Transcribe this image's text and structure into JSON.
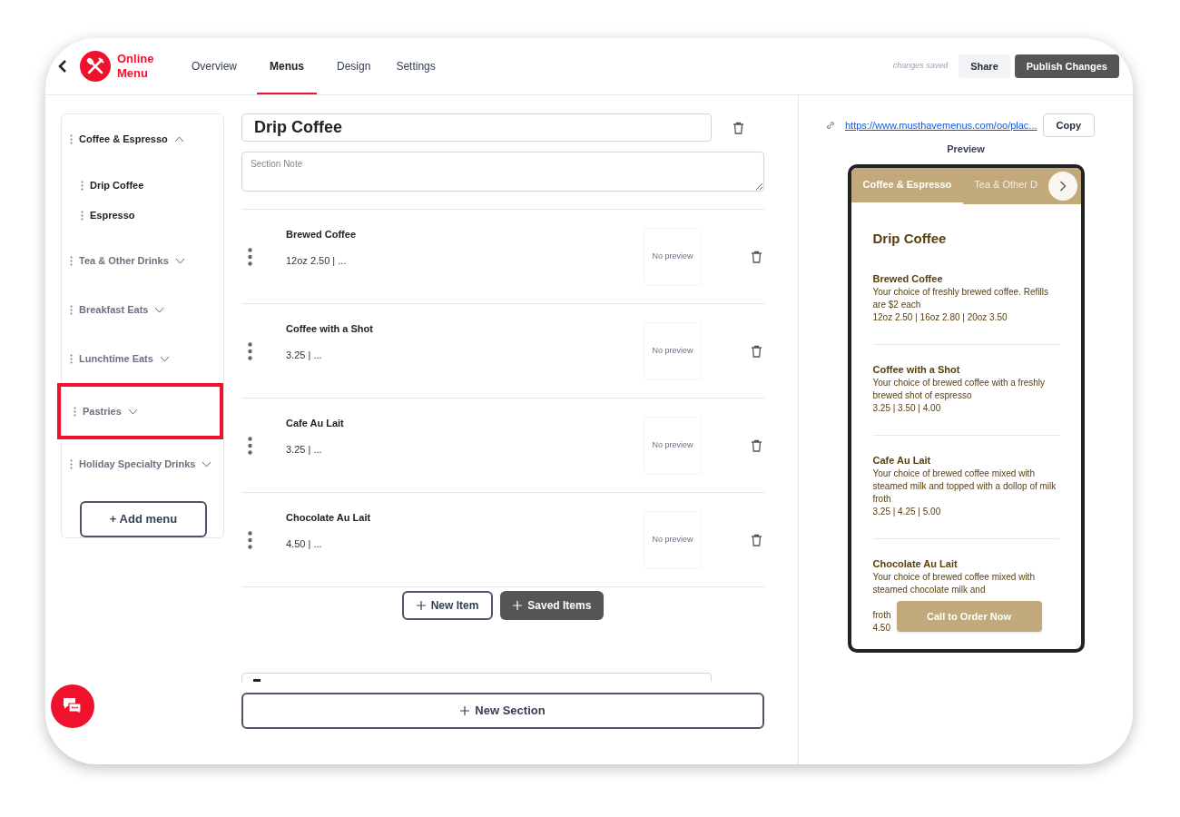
{
  "header": {
    "app_name": "Online Menu",
    "tabs": [
      {
        "label": "Overview",
        "selected": false
      },
      {
        "label": "Menus",
        "selected": true
      },
      {
        "label": "Design",
        "selected": false
      },
      {
        "label": "Settings",
        "selected": false
      }
    ],
    "save_status": "changes saved",
    "share": "Share",
    "publish": "Publish Changes"
  },
  "sidebar": {
    "menus": [
      {
        "label": "Coffee & Espresso",
        "expanded": true,
        "highlighted": false,
        "children": [
          {
            "label": "Drip Coffee"
          },
          {
            "label": "Espresso"
          }
        ]
      },
      {
        "label": "Tea & Other Drinks",
        "expanded": false,
        "highlighted": false
      },
      {
        "label": "Breakfast Eats",
        "expanded": false,
        "highlighted": false
      },
      {
        "label": "Lunchtime Eats",
        "expanded": false,
        "highlighted": false
      },
      {
        "label": "Pastries",
        "expanded": false,
        "highlighted": true
      },
      {
        "label": "Holiday Specialty Drinks",
        "expanded": false,
        "highlighted": false
      }
    ],
    "add_menu": "+ Add menu"
  },
  "editor": {
    "section_title": "Drip Coffee",
    "section_note_placeholder": "Section Note",
    "items": [
      {
        "name": "Brewed Coffee",
        "price": "12oz 2.50 | ...",
        "image": "No preview"
      },
      {
        "name": "Coffee with a Shot",
        "price": "3.25 | ...",
        "image": "No preview"
      },
      {
        "name": "Cafe Au Lait",
        "price": "3.25 | ...",
        "image": "No preview"
      },
      {
        "name": "Chocolate Au Lait",
        "price": "4.50 | ...",
        "image": "No preview"
      }
    ],
    "new_item": "New Item",
    "saved_items": "Saved Items",
    "new_section": "New Section"
  },
  "preview": {
    "url": "https://www.musthavemenus.com/oo/plac...",
    "copy": "Copy",
    "label": "Preview",
    "tabs": [
      {
        "label": "Coffee & Espresso",
        "selected": true
      },
      {
        "label": "Tea & Other D",
        "selected": false
      }
    ],
    "section_title": "Drip Coffee",
    "items": [
      {
        "name": "Brewed Coffee",
        "description": "Your choice of freshly brewed coffee. Refills are $2 each",
        "prices": "12oz 2.50 | 16oz 2.80 | 20oz 3.50"
      },
      {
        "name": "Coffee with a Shot",
        "description": "Your choice of brewed coffee with a freshly brewed shot of espresso",
        "prices": "3.25 | 3.50 | 4.00"
      },
      {
        "name": "Cafe Au Lait",
        "description": "Your choice of brewed coffee mixed with steamed milk and topped with a dollop of milk froth",
        "prices": "3.25 | 4.25 | 5.00"
      },
      {
        "name": "Chocolate Au Lait",
        "description": "Your choice of brewed coffee mixed with steamed chocolate milk and",
        "description_tail": "froth",
        "prices": "4.50"
      }
    ],
    "call_button": "Call to Order Now"
  }
}
